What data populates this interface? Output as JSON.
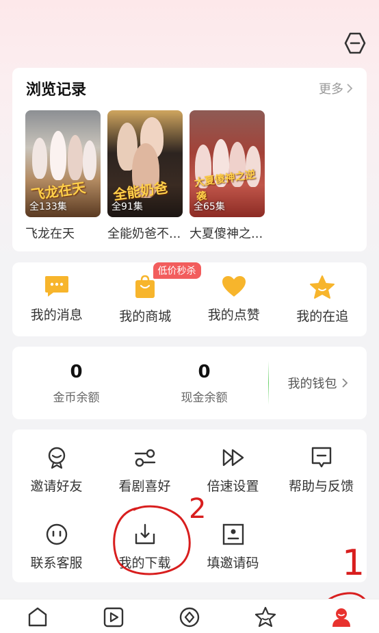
{
  "history": {
    "title": "浏览记录",
    "more_label": "更多",
    "items": [
      {
        "episodes": "全133集",
        "name": "飞龙在天",
        "poster_text": "飞龙在天"
      },
      {
        "episodes": "全91集",
        "name": "全能奶爸不...",
        "poster_text": "全能奶爸"
      },
      {
        "episodes": "全65集",
        "name": "大夏傻神之...",
        "poster_text": "大夏傻神之逆袭"
      }
    ]
  },
  "quick_menu": {
    "badge": "低价秒杀",
    "items": [
      {
        "label": "我的消息",
        "icon": "message-icon"
      },
      {
        "label": "我的商城",
        "icon": "shopping-bag-icon"
      },
      {
        "label": "我的点赞",
        "icon": "heart-icon"
      },
      {
        "label": "我的在追",
        "icon": "star-icon"
      }
    ]
  },
  "wallet": {
    "coins_value": "0",
    "coins_label": "金币余额",
    "cash_value": "0",
    "cash_label": "现金余额",
    "wallet_link": "我的钱包"
  },
  "tools": [
    {
      "label": "邀请好友",
      "icon": "invite-icon"
    },
    {
      "label": "看剧喜好",
      "icon": "preferences-icon"
    },
    {
      "label": "倍速设置",
      "icon": "playback-speed-icon"
    },
    {
      "label": "帮助与反馈",
      "icon": "feedback-icon"
    },
    {
      "label": "联系客服",
      "icon": "customer-service-icon"
    },
    {
      "label": "我的下载",
      "icon": "download-icon"
    },
    {
      "label": "填邀请码",
      "icon": "invite-code-icon"
    }
  ],
  "annotations": {
    "mark_1": "1",
    "mark_2": "2"
  },
  "bottom_nav": [
    {
      "icon": "home-icon"
    },
    {
      "icon": "play-icon"
    },
    {
      "icon": "discover-icon"
    },
    {
      "icon": "favorites-icon"
    },
    {
      "icon": "profile-icon",
      "active": true
    }
  ],
  "colors": {
    "accent": "#f7b52c",
    "active_nav": "#e8322e",
    "annotation": "#d81e1e",
    "badge": "#f25d5d"
  }
}
